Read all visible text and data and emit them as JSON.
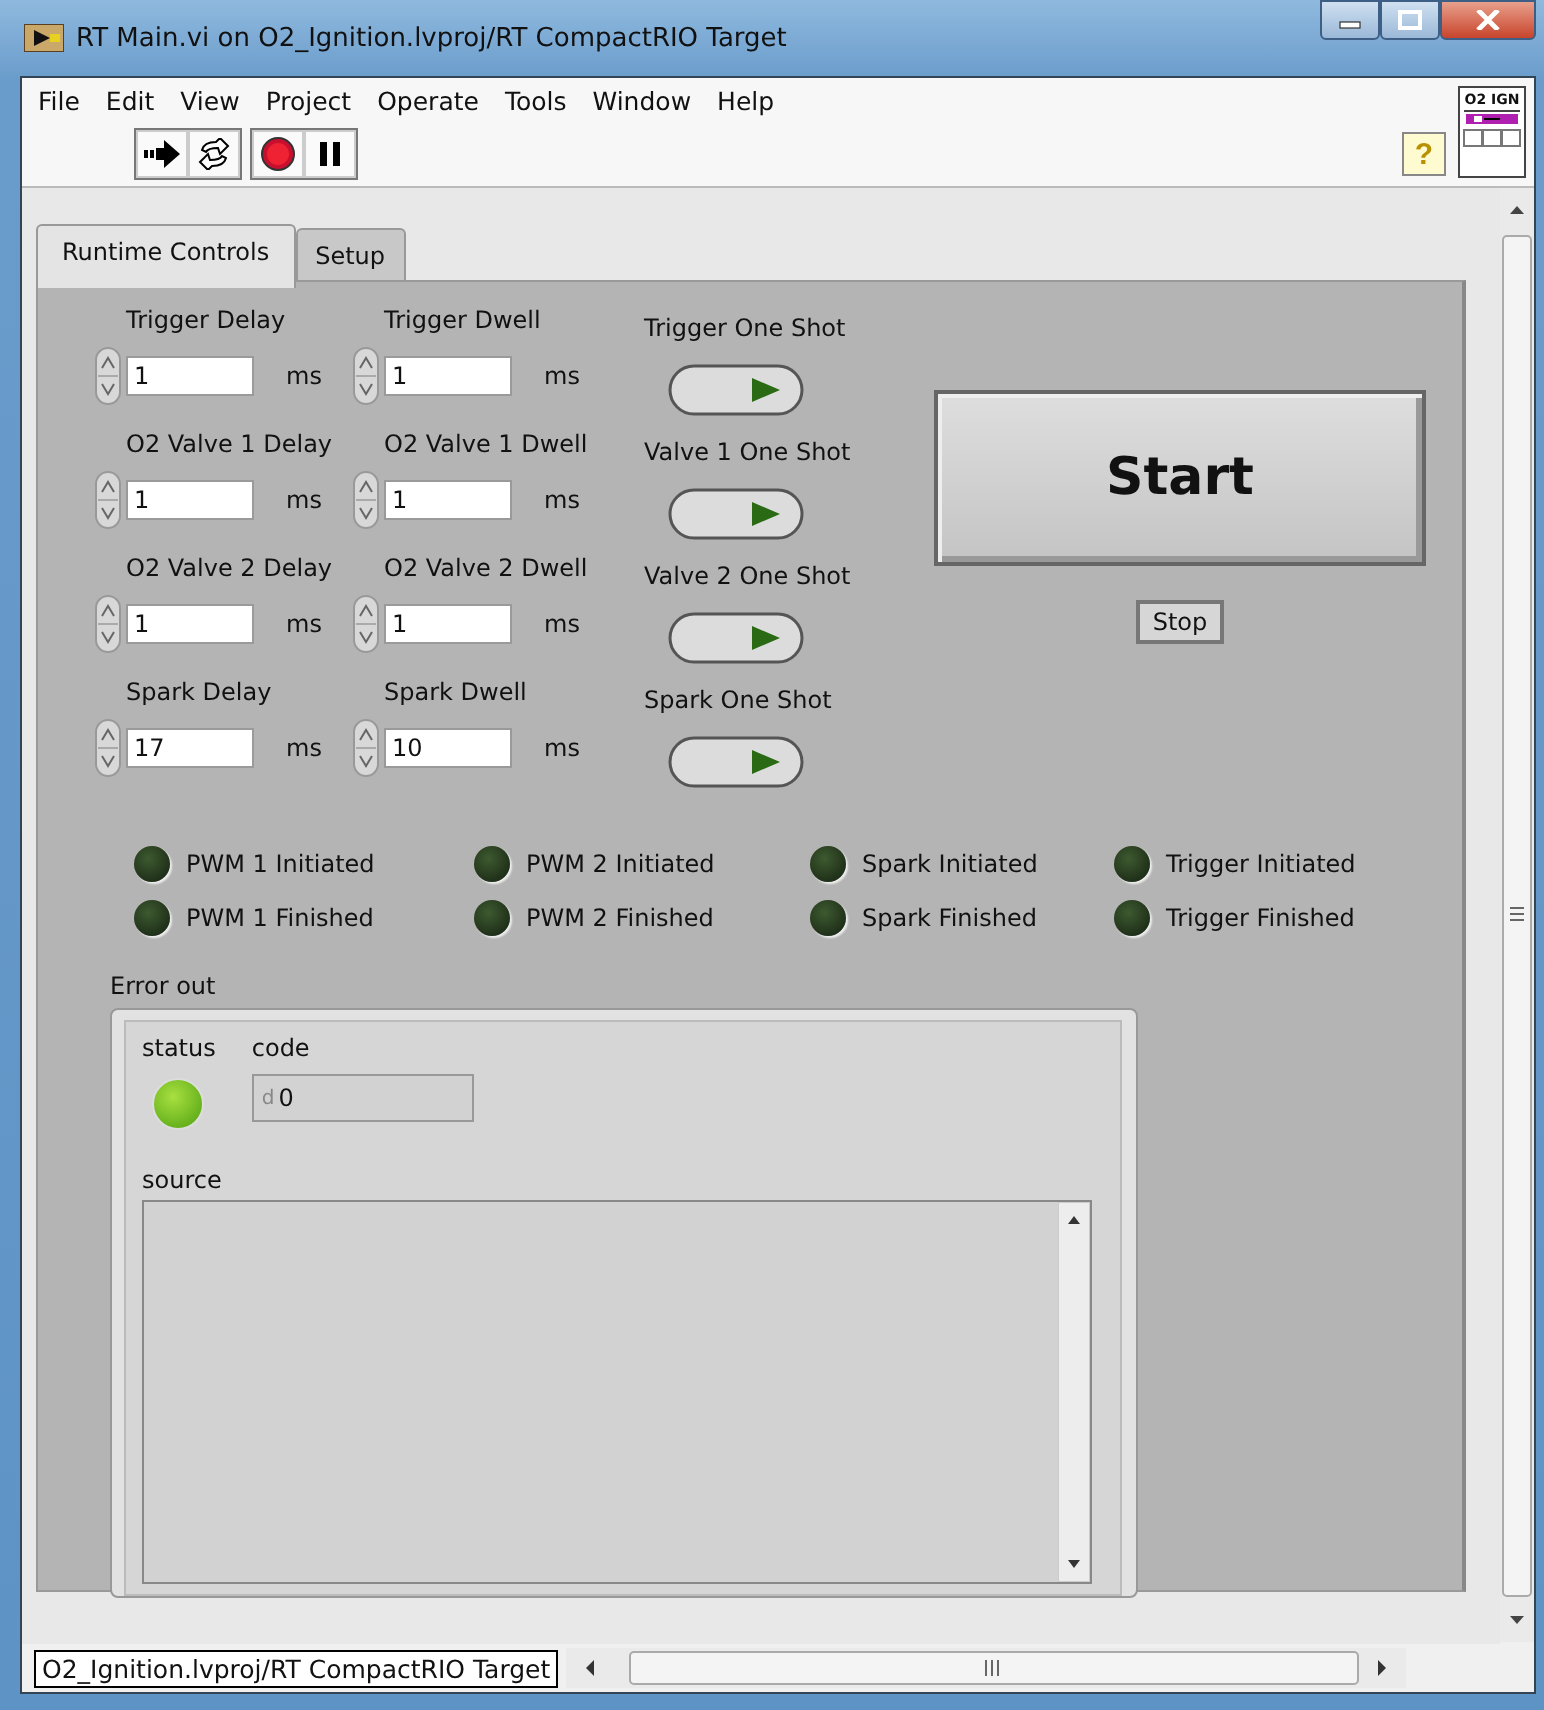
{
  "window": {
    "title": "RT Main.vi on O2_Ignition.lvproj/RT CompactRIO Target"
  },
  "menu": [
    "File",
    "Edit",
    "View",
    "Project",
    "Operate",
    "Tools",
    "Window",
    "Help"
  ],
  "toolbar": {
    "help_button": "?",
    "vi_icon_label": "O2 IGN"
  },
  "tabs": [
    {
      "label": "Runtime Controls",
      "selected": true
    },
    {
      "label": "Setup",
      "selected": false
    }
  ],
  "timing_rows": [
    {
      "delay": {
        "label": "Trigger Delay",
        "value": "1",
        "unit": "ms"
      },
      "dwell": {
        "label": "Trigger Dwell",
        "value": "1",
        "unit": "ms"
      },
      "one_shot": {
        "label": "Trigger One Shot",
        "on": false
      }
    },
    {
      "delay": {
        "label": "O2 Valve 1 Delay",
        "value": "1",
        "unit": "ms"
      },
      "dwell": {
        "label": "O2 Valve 1 Dwell",
        "value": "1",
        "unit": "ms"
      },
      "one_shot": {
        "label": "Valve 1 One Shot",
        "on": false
      }
    },
    {
      "delay": {
        "label": "O2 Valve 2 Delay",
        "value": "1",
        "unit": "ms"
      },
      "dwell": {
        "label": "O2 Valve 2 Dwell",
        "value": "1",
        "unit": "ms"
      },
      "one_shot": {
        "label": "Valve 2 One Shot",
        "on": false
      }
    },
    {
      "delay": {
        "label": "Spark Delay",
        "value": "17",
        "unit": "ms"
      },
      "dwell": {
        "label": "Spark Dwell",
        "value": "10",
        "unit": "ms"
      },
      "one_shot": {
        "label": "Spark One Shot",
        "on": false
      }
    }
  ],
  "start_button": "Start",
  "stop_button": "Stop",
  "indicators": [
    {
      "label": "PWM 1 Initiated",
      "on": false
    },
    {
      "label": "PWM 2 Initiated",
      "on": false
    },
    {
      "label": "Spark Initiated",
      "on": false
    },
    {
      "label": "Trigger Initiated",
      "on": false
    },
    {
      "label": "PWM 1 Finished",
      "on": false
    },
    {
      "label": "PWM 2 Finished",
      "on": false
    },
    {
      "label": "Spark Finished",
      "on": false
    },
    {
      "label": "Trigger Finished",
      "on": false
    }
  ],
  "error_out": {
    "label": "Error out",
    "status_label": "status",
    "status_on": true,
    "code_label": "code",
    "code_radix": "d",
    "code": "0",
    "source_label": "source"
  },
  "status_bar": {
    "path": "O2_Ignition.lvproj/RT CompactRIO Target"
  }
}
